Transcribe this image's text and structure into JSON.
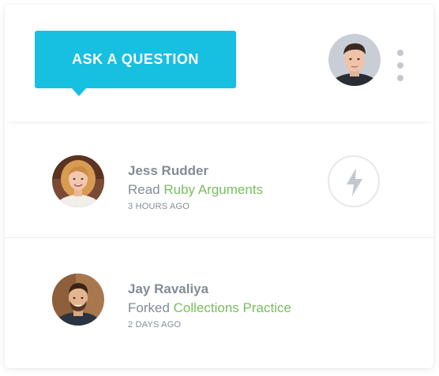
{
  "header": {
    "ask_button_label": "ASK A QUESTION",
    "accent_color": "#17bfe0",
    "user_avatar_icon": "user-avatar",
    "menu_icon": "vertical-ellipsis-icon"
  },
  "feed": [
    {
      "name": "Jess Rudder",
      "verb": "Read",
      "item": "Ruby Arguments",
      "time": "3 HOURS  AGO",
      "action_icon": "lightning-bolt-icon"
    },
    {
      "name": "Jay Ravaliya",
      "verb": "Forked",
      "item": "Collections Practice",
      "time": "2 DAYS AGO"
    }
  ],
  "colors": {
    "link_green": "#78be5f",
    "text_gray": "#848b96",
    "icon_gray": "#c3c8cf"
  }
}
